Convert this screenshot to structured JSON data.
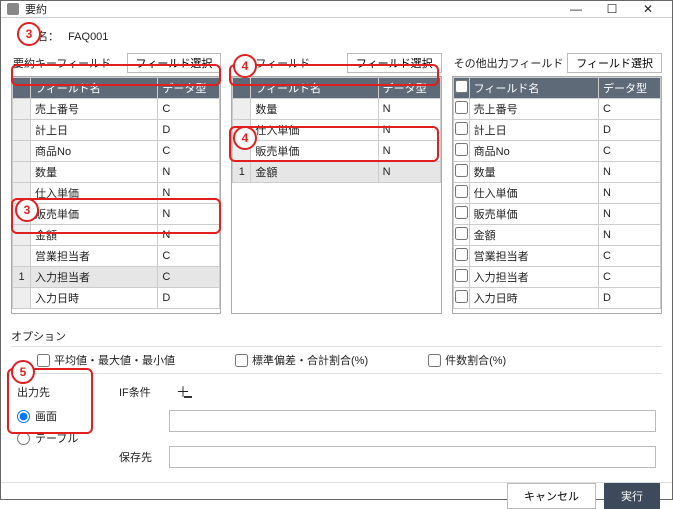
{
  "window": {
    "title": "要約"
  },
  "name": {
    "label": "名：",
    "value": "FAQ001"
  },
  "panels": {
    "key": {
      "title": "要約キーフィールド",
      "select_btn": "フィールド選択",
      "headers": [
        "",
        "フィールド名",
        "データ型"
      ],
      "rows": [
        {
          "n": "",
          "f": "売上番号",
          "t": "C"
        },
        {
          "n": "",
          "f": "計上日",
          "t": "D"
        },
        {
          "n": "",
          "f": "商品No",
          "t": "C"
        },
        {
          "n": "",
          "f": "数量",
          "t": "N"
        },
        {
          "n": "",
          "f": "仕入単価",
          "t": "N"
        },
        {
          "n": "",
          "f": "販売単価",
          "t": "N"
        },
        {
          "n": "",
          "f": "金額",
          "t": "N"
        },
        {
          "n": "",
          "f": "営業担当者",
          "t": "C"
        },
        {
          "n": "1",
          "f": "入力担当者",
          "t": "C",
          "sel": true
        },
        {
          "n": "",
          "f": "入力日時",
          "t": "D"
        }
      ]
    },
    "sub": {
      "title": "小計フィールド",
      "select_btn": "フィールド選択",
      "headers": [
        "",
        "フィールド名",
        "データ型"
      ],
      "rows": [
        {
          "n": "",
          "f": "数量",
          "t": "N"
        },
        {
          "n": "",
          "f": "仕入単価",
          "t": "N"
        },
        {
          "n": "",
          "f": "販売単価",
          "t": "N"
        },
        {
          "n": "1",
          "f": "金額",
          "t": "N",
          "sel": true
        }
      ]
    },
    "other": {
      "title": "その他出力フィールド",
      "select_btn": "フィールド選択",
      "headers": [
        "",
        "フィールド名",
        "データ型"
      ],
      "rows": [
        {
          "n": "",
          "f": "売上番号",
          "t": "C"
        },
        {
          "n": "",
          "f": "計上日",
          "t": "D"
        },
        {
          "n": "",
          "f": "商品No",
          "t": "C"
        },
        {
          "n": "",
          "f": "数量",
          "t": "N"
        },
        {
          "n": "",
          "f": "仕入単価",
          "t": "N"
        },
        {
          "n": "",
          "f": "販売単価",
          "t": "N"
        },
        {
          "n": "",
          "f": "金額",
          "t": "N"
        },
        {
          "n": "",
          "f": "営業担当者",
          "t": "C"
        },
        {
          "n": "",
          "f": "入力担当者",
          "t": "C"
        },
        {
          "n": "",
          "f": "入力日時",
          "t": "D"
        }
      ]
    }
  },
  "options": {
    "section": "オプション",
    "avg": "平均値・最大値・最小値",
    "std": "標準偏差・合計割合(%)",
    "cnt": "件数割合(%)"
  },
  "dest": {
    "title": "出力先",
    "screen": "画面",
    "table": "テーブル"
  },
  "form": {
    "if_label": "IF条件",
    "save_label": "保存先"
  },
  "footer": {
    "cancel": "キャンセル",
    "run": "実行"
  },
  "badges": {
    "b3a": "3",
    "b4a": "4",
    "b4b": "4",
    "b3b": "3",
    "b5": "5"
  }
}
